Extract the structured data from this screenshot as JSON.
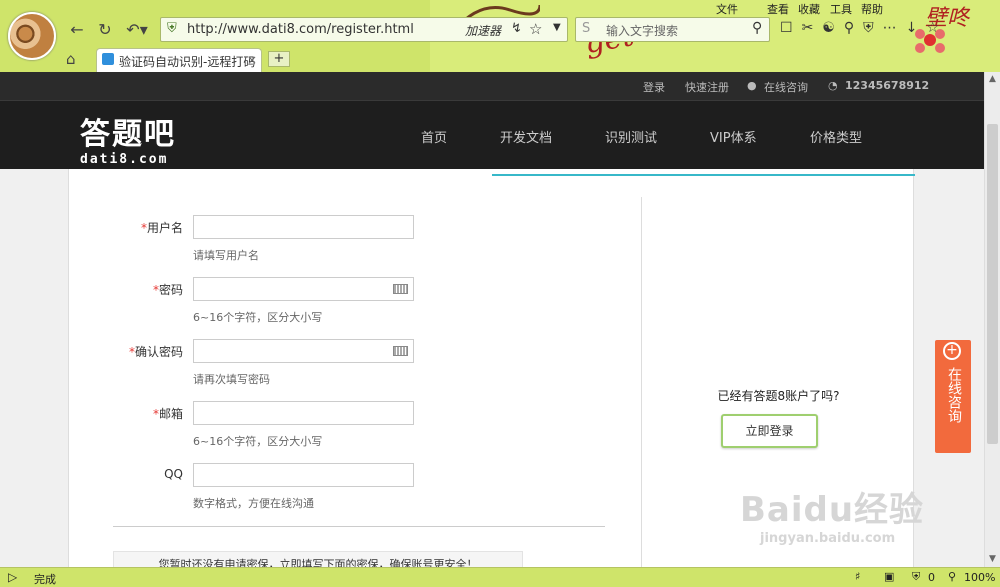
{
  "browser": {
    "url": "http://www.dati8.com/register.html",
    "accelerator_label": "加速器",
    "search_placeholder": "输入文字搜索",
    "menu": [
      "文件",
      "查看",
      "收藏",
      "工具",
      "帮助"
    ],
    "tab_title": "验证码自动识别-远程打码",
    "new_tab_label": "+",
    "skin_text": "壁咚",
    "skin_text2": "get"
  },
  "topbar": {
    "login": "登录",
    "register": "快速注册",
    "online": "在线咨询",
    "phone": "12345678912"
  },
  "header": {
    "logo_cn": "答题吧",
    "logo_en": "dati8.com",
    "nav": [
      "首页",
      "开发文档",
      "识别测试",
      "VIP体系",
      "价格类型"
    ]
  },
  "form": {
    "fields": [
      {
        "label": "用户名",
        "required": true,
        "hint": "请填写用户名"
      },
      {
        "label": "密码",
        "required": true,
        "hint": "6~16个字符，区分大小写"
      },
      {
        "label": "确认密码",
        "required": true,
        "hint": "请再次填写密码"
      },
      {
        "label": "邮箱",
        "required": true,
        "hint": "6~16个字符，区分大小写"
      },
      {
        "label": "QQ",
        "required": false,
        "hint": "数字格式，方便在线沟通"
      }
    ],
    "required_mark": "*",
    "notice": "您暂时还没有申请密保，立即填写下面的密保，确保账号更安全！"
  },
  "side": {
    "have_account": "已经有答题8账户了吗?",
    "login_button": "立即登录"
  },
  "consult_widget": {
    "label": "在线咨询"
  },
  "watermark": {
    "line1": "Baidu经验",
    "line2": "jingyan.baidu.com"
  },
  "statusbar": {
    "status": "完成",
    "zoom": "100%",
    "count": "0"
  }
}
